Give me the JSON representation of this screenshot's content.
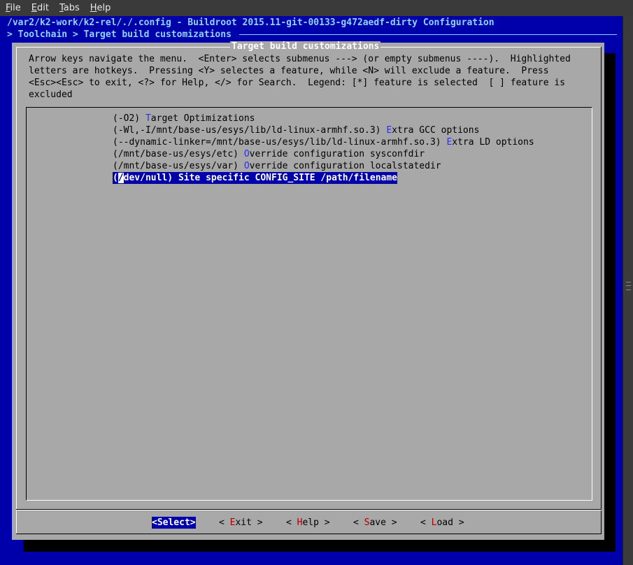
{
  "menubar": {
    "items": [
      {
        "hotkey": "F",
        "rest": "ile"
      },
      {
        "hotkey": "E",
        "rest": "dit"
      },
      {
        "hotkey": "T",
        "rest": "abs"
      },
      {
        "hotkey": "H",
        "rest": "elp"
      }
    ]
  },
  "terminal": {
    "title_line": "/var2/k2-work/k2-rel/./.config - Buildroot 2015.11-git-00133-g472aedf-dirty Configuration",
    "breadcrumb": "> Toolchain > Target build customizations"
  },
  "dialog": {
    "title": "Target build customizations",
    "help_lines": [
      "Arrow keys navigate the menu.  <Enter> selects submenus ---> (or empty submenus ----).  Highlighted",
      "letters are hotkeys.  Pressing <Y> selectes a feature, while <N> will exclude a feature.  Press",
      "<Esc><Esc> to exit, <?> for Help, </> for Search.  Legend: [*] feature is selected  [ ] feature is",
      "excluded"
    ],
    "items": [
      {
        "value": "(-O2) ",
        "hotkey": "T",
        "rest": "arget Optimizations",
        "selected": false
      },
      {
        "value": "(-Wl,-I/mnt/base-us/esys/lib/ld-linux-armhf.so.3) ",
        "hotkey": "E",
        "rest": "xtra GCC options",
        "selected": false
      },
      {
        "value": "(--dynamic-linker=/mnt/base-us/esys/lib/ld-linux-armhf.so.3) ",
        "hotkey": "E",
        "rest": "xtra LD options",
        "selected": false
      },
      {
        "value": "(/mnt/base-us/esys/etc) ",
        "hotkey": "O",
        "rest": "verride configuration sysconfdir",
        "selected": false
      },
      {
        "value": "(/mnt/base-us/esys/var) ",
        "hotkey": "O",
        "rest": "verride configuration localstatedir",
        "selected": false
      },
      {
        "value": "(/dev/null) ",
        "hotkey": "S",
        "rest": "ite specific CONFIG_SITE /path/filename",
        "selected": true
      }
    ],
    "buttons": [
      {
        "label": "<Select>",
        "active": true
      },
      {
        "pre": "< ",
        "key": "E",
        "post": "xit >",
        "active": false
      },
      {
        "pre": "< ",
        "key": "H",
        "post": "elp >",
        "active": false
      },
      {
        "pre": "< ",
        "key": "S",
        "post": "ave >",
        "active": false
      },
      {
        "pre": "< ",
        "key": "L",
        "post": "oad >",
        "active": false
      }
    ]
  },
  "colors": {
    "terminal_bg": "#0000aa",
    "dialog_bg": "#a8a8a8",
    "title_text": "#8fd3ff",
    "hotkey": "#3030e0",
    "button_hotkey": "#aa0000"
  }
}
